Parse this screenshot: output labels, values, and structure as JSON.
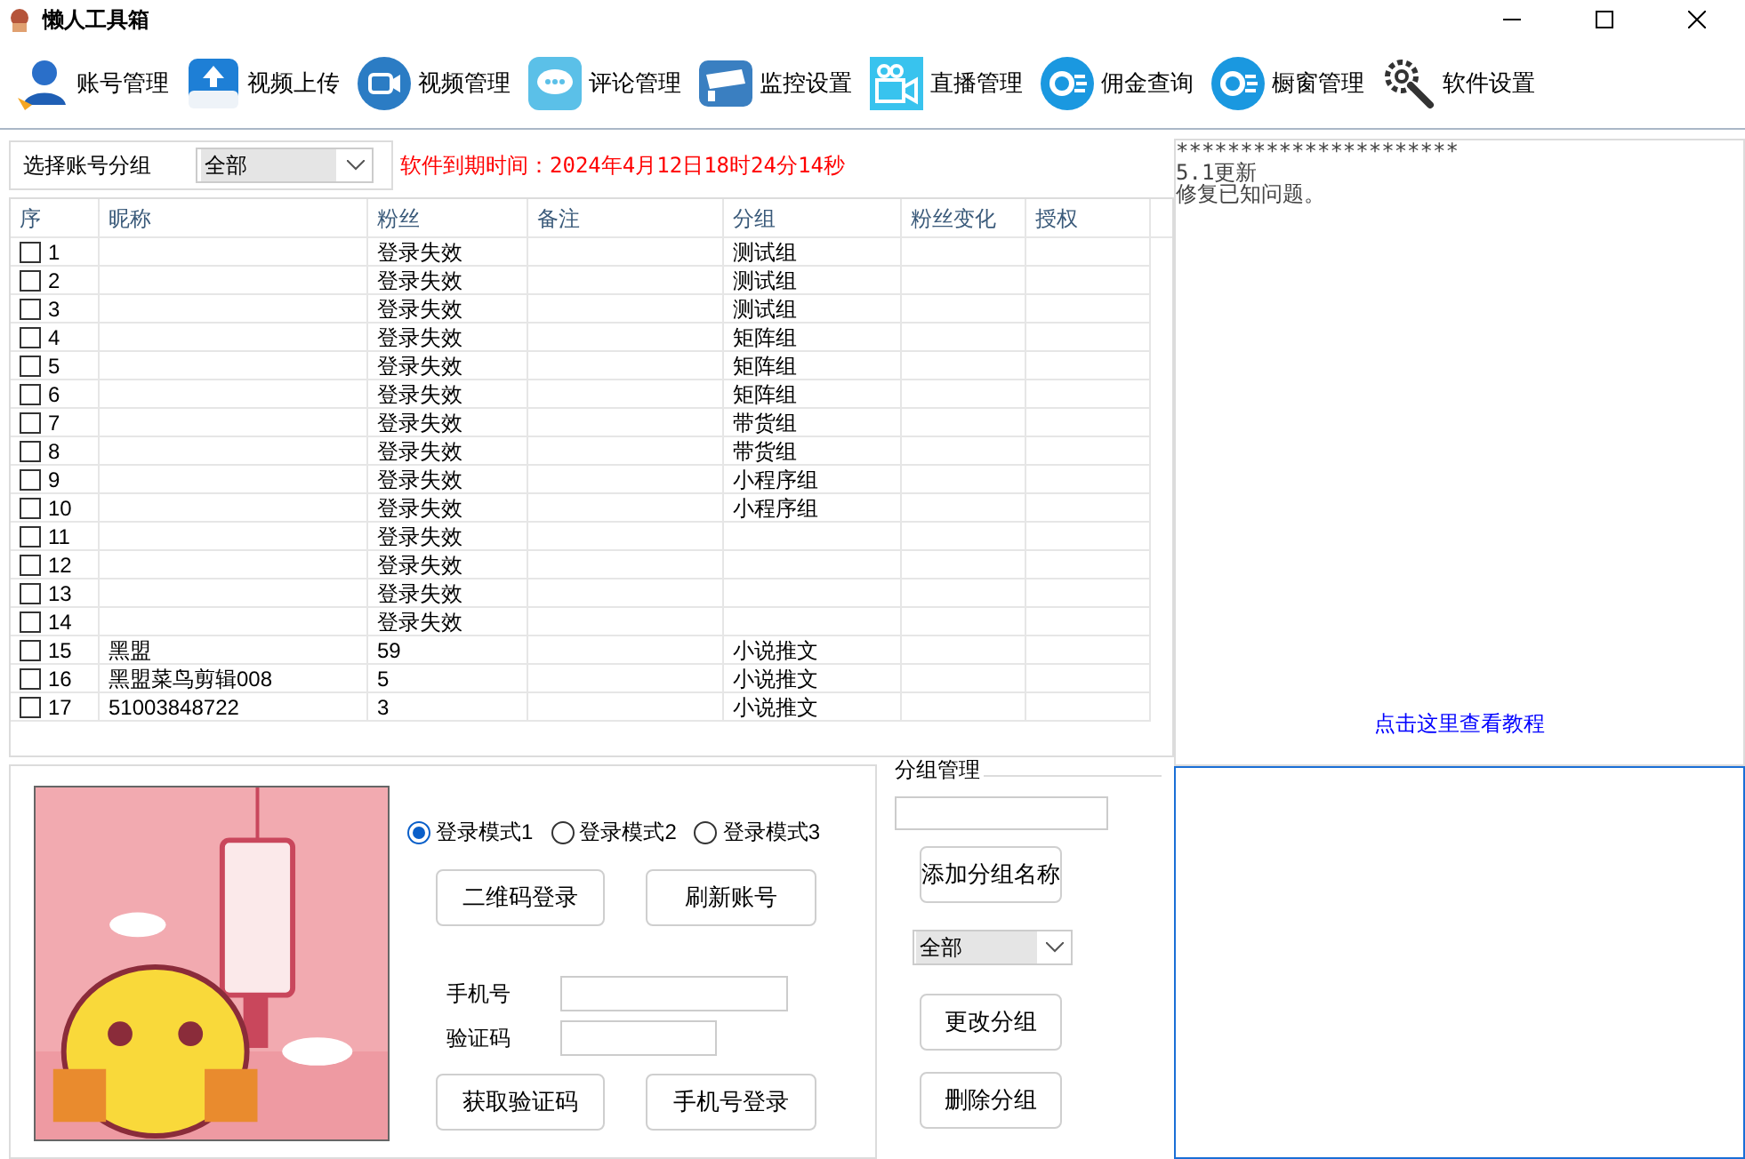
{
  "window": {
    "title": "懒人工具箱"
  },
  "toolbar": [
    {
      "label": "账号管理",
      "kind": "user"
    },
    {
      "label": "视频上传",
      "kind": "upload"
    },
    {
      "label": "视频管理",
      "kind": "video"
    },
    {
      "label": "评论管理",
      "kind": "chat"
    },
    {
      "label": "监控设置",
      "kind": "camera"
    },
    {
      "label": "直播管理",
      "kind": "live"
    },
    {
      "label": "佣金查询",
      "kind": "coin"
    },
    {
      "label": "橱窗管理",
      "kind": "coin"
    },
    {
      "label": "软件设置",
      "kind": "gear"
    }
  ],
  "group_select": {
    "label": "选择账号分组",
    "value": "全部"
  },
  "expiry": "软件到期时间：2024年4月12日18时24分14秒",
  "table": {
    "columns": [
      "序",
      "昵称",
      "粉丝",
      "备注",
      "分组",
      "粉丝变化",
      "授权"
    ],
    "rows": [
      {
        "index": "1",
        "nickname": "",
        "fans": "登录失效",
        "group": "测试组",
        "checked": false
      },
      {
        "index": "2",
        "nickname": "",
        "fans": "登录失效",
        "group": "测试组",
        "checked": false
      },
      {
        "index": "3",
        "nickname": "",
        "fans": "登录失效",
        "group": "测试组",
        "checked": false
      },
      {
        "index": "4",
        "nickname": "",
        "fans": "登录失效",
        "group": "矩阵组",
        "checked": false
      },
      {
        "index": "5",
        "nickname": "",
        "fans": "登录失效",
        "group": "矩阵组",
        "checked": false
      },
      {
        "index": "6",
        "nickname": "",
        "fans": "登录失效",
        "group": "矩阵组",
        "checked": false
      },
      {
        "index": "7",
        "nickname": "",
        "fans": "登录失效",
        "group": "带货组",
        "checked": false
      },
      {
        "index": "8",
        "nickname": "",
        "fans": "登录失效",
        "group": "带货组",
        "checked": false
      },
      {
        "index": "9",
        "nickname": "",
        "fans": "登录失效",
        "group": "小程序组",
        "checked": false
      },
      {
        "index": "10",
        "nickname": "",
        "fans": "登录失效",
        "group": "小程序组",
        "checked": false
      },
      {
        "index": "11",
        "nickname": "",
        "fans": "登录失效",
        "group": "",
        "checked": false
      },
      {
        "index": "12",
        "nickname": "",
        "fans": "登录失效",
        "group": "",
        "checked": false
      },
      {
        "index": "13",
        "nickname": "",
        "fans": "登录失效",
        "group": "",
        "checked": false
      },
      {
        "index": "14",
        "nickname": "",
        "fans": "登录失效",
        "group": "",
        "checked": false
      },
      {
        "index": "15",
        "nickname": "黑盟",
        "fans": "59",
        "group": "小说推文",
        "checked": false
      },
      {
        "index": "16",
        "nickname": "黑盟菜鸟剪辑008",
        "fans": "5",
        "group": "小说推文",
        "checked": false
      },
      {
        "index": "17",
        "nickname": "51003848722",
        "fans": "3",
        "group": "小说推文",
        "checked": false
      }
    ]
  },
  "notes": [
    "**********************",
    "5.1更新",
    "修复已知问题。"
  ],
  "tutorial_link": "点击这里查看教程",
  "login": {
    "modes": [
      {
        "label": "登录模式1",
        "selected": true
      },
      {
        "label": "登录模式2",
        "selected": false
      },
      {
        "label": "登录模式3",
        "selected": false
      }
    ],
    "qr_button": "二维码登录",
    "refresh_button": "刷新账号",
    "phone_label": "手机号",
    "code_label": "验证码",
    "get_code_button": "获取验证码",
    "phone_login_button": "手机号登录"
  },
  "group_manage": {
    "title": "分组管理",
    "add_button": "添加分组名称",
    "select_value": "全部",
    "change_button": "更改分组",
    "delete_button": "删除分组"
  }
}
